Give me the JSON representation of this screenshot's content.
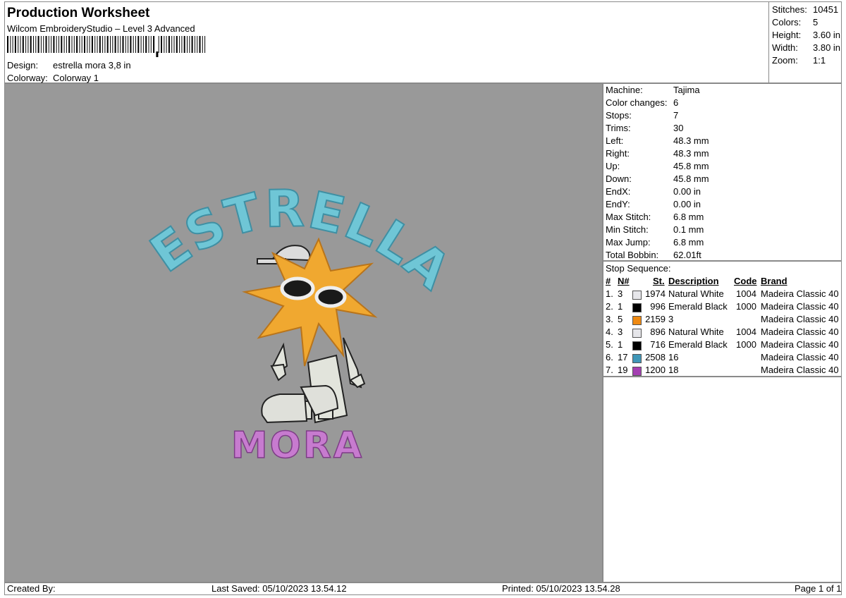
{
  "header": {
    "title": "Production Worksheet",
    "software": "Wilcom EmbroideryStudio – Level 3 Advanced",
    "barcode_text": "||||||||||||||||||||||||||||||||||||||||||||||||||||||||||,|||||||||||||||||||",
    "design_label": "Design:",
    "design_value": "estrella mora 3,8 in",
    "colorway_label": "Colorway:",
    "colorway_value": "Colorway 1"
  },
  "summary": [
    {
      "label": "Stitches:",
      "value": "10451"
    },
    {
      "label": "Colors:",
      "value": "5"
    },
    {
      "label": "Height:",
      "value": "3.60 in"
    },
    {
      "label": "Width:",
      "value": "3.80 in"
    },
    {
      "label": "Zoom:",
      "value": "1:1"
    }
  ],
  "machine_info": [
    {
      "label": "Machine:",
      "value": "Tajima"
    },
    {
      "label": "Color changes:",
      "value": "6"
    },
    {
      "label": "Stops:",
      "value": "7"
    },
    {
      "label": "Trims:",
      "value": "30"
    },
    {
      "label": "Left:",
      "value": "48.3 mm"
    },
    {
      "label": "Right:",
      "value": "48.3 mm"
    },
    {
      "label": "Up:",
      "value": "45.8 mm"
    },
    {
      "label": "Down:",
      "value": "45.8 mm"
    },
    {
      "label": "EndX:",
      "value": "0.00 in"
    },
    {
      "label": "EndY:",
      "value": "0.00 in"
    },
    {
      "label": "Max Stitch:",
      "value": "6.8 mm"
    },
    {
      "label": "Min Stitch:",
      "value": "0.1 mm"
    },
    {
      "label": "Max Jump:",
      "value": "6.8 mm"
    },
    {
      "label": "Total Bobbin:",
      "value": "62.01ft"
    }
  ],
  "stop_sequence": {
    "title": "Stop Sequence:",
    "headers": {
      "num": "#",
      "n": "N#",
      "st": "St.",
      "desc": "Description",
      "code": "Code",
      "brand": "Brand"
    },
    "rows": [
      {
        "num": "1.",
        "n": "3",
        "color": "#e6e6ea",
        "st": "1974",
        "desc": "Natural White",
        "code": "1004",
        "brand": "Madeira Classic 40"
      },
      {
        "num": "2.",
        "n": "1",
        "color": "#000000",
        "st": "996",
        "desc": "Emerald Black",
        "code": "1000",
        "brand": "Madeira Classic 40"
      },
      {
        "num": "3.",
        "n": "5",
        "color": "#ef8a12",
        "st": "2159",
        "desc": "3",
        "code": "",
        "brand": "Madeira Classic 40"
      },
      {
        "num": "4.",
        "n": "3",
        "color": "#e6e6ea",
        "st": "896",
        "desc": "Natural White",
        "code": "1004",
        "brand": "Madeira Classic 40"
      },
      {
        "num": "5.",
        "n": "1",
        "color": "#000000",
        "st": "716",
        "desc": "Emerald Black",
        "code": "1000",
        "brand": "Madeira Classic 40"
      },
      {
        "num": "6.",
        "n": "17",
        "color": "#3f97b8",
        "st": "2508",
        "desc": "16",
        "code": "",
        "brand": "Madeira Classic 40"
      },
      {
        "num": "7.",
        "n": "19",
        "color": "#a43fb2",
        "st": "1200",
        "desc": "18",
        "code": "",
        "brand": "Madeira Classic 40"
      }
    ]
  },
  "design": {
    "top_text": "ESTRELLA",
    "bottom_text": "MORA",
    "canvas_color": "#999999",
    "top_color": "#6fc6d6",
    "bottom_color": "#c77bcf",
    "star_color": "#f0a830"
  },
  "footer": {
    "created": "Created By:",
    "saved": "Last Saved: 05/10/2023 13.54.12",
    "printed": "Printed: 05/10/2023 13.54.28",
    "page": "Page 1 of 1"
  }
}
